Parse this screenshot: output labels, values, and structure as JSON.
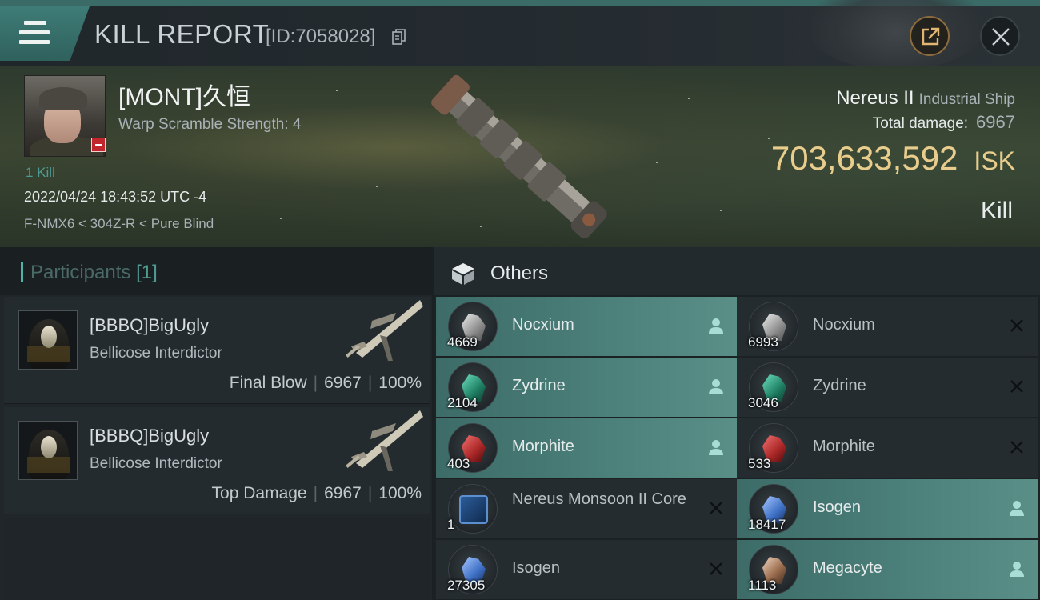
{
  "header": {
    "title": "KILL REPORT",
    "kill_id": "[ID:7058028]"
  },
  "victim": {
    "name": "[MONT]久恒",
    "warp_scramble": "Warp Scramble Strength: 4",
    "kills": "1 Kill",
    "timestamp": "2022/04/24 18:43:52 UTC -4",
    "location": "F-NMX6 < 304Z-R < Pure Blind"
  },
  "ship": {
    "name": "Nereus II",
    "class": "Industrial Ship",
    "total_damage_label": "Total damage:",
    "total_damage": "6967",
    "isk_value": "703,633,592",
    "isk_unit": "ISK",
    "result": "Kill"
  },
  "participants": {
    "title": "Participants",
    "count": "[1]",
    "items": [
      {
        "name": "[BBBQ]BigUgly",
        "ship": "Bellicose Interdictor",
        "role": "Final Blow",
        "damage": "6967",
        "percent": "100%"
      },
      {
        "name": "[BBBQ]BigUgly",
        "ship": "Bellicose Interdictor",
        "role": "Top Damage",
        "damage": "6967",
        "percent": "100%"
      }
    ]
  },
  "others": {
    "title": "Others",
    "items": [
      {
        "name": "Nocxium",
        "qty": "4669",
        "status": "dropped",
        "ore": "nocx"
      },
      {
        "name": "Nocxium",
        "qty": "6993",
        "status": "destroyed",
        "ore": "nocx"
      },
      {
        "name": "Zydrine",
        "qty": "2104",
        "status": "dropped",
        "ore": "zyd"
      },
      {
        "name": "Zydrine",
        "qty": "3046",
        "status": "destroyed",
        "ore": "zyd"
      },
      {
        "name": "Morphite",
        "qty": "403",
        "status": "dropped",
        "ore": "morph"
      },
      {
        "name": "Morphite",
        "qty": "533",
        "status": "destroyed",
        "ore": "morph"
      },
      {
        "name": "Nereus Monsoon II Core",
        "qty": "1",
        "status": "destroyed",
        "ore": "core"
      },
      {
        "name": "Isogen",
        "qty": "18417",
        "status": "dropped",
        "ore": "iso"
      },
      {
        "name": "Isogen",
        "qty": "27305",
        "status": "destroyed",
        "ore": "iso"
      },
      {
        "name": "Megacyte",
        "qty": "1113",
        "status": "dropped",
        "ore": "mega"
      }
    ]
  },
  "colors": {
    "accent_teal": "#4b7f79",
    "isk_gold": "#e8cd8c",
    "badge_red": "#c0262b"
  },
  "icons": [
    "menu-icon",
    "copy-icon",
    "share-icon",
    "close-icon",
    "cube-icon",
    "person-icon",
    "x-icon"
  ]
}
